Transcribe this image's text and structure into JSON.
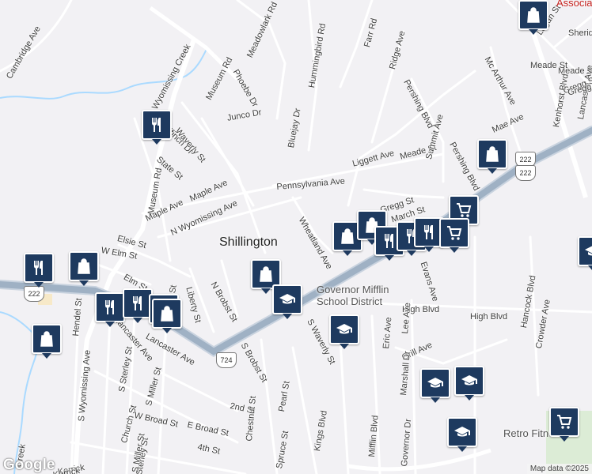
{
  "town": "Shillington",
  "labels": [
    "Cambridge Ave",
    "Meadowlark Rd",
    "Wyomissing Creek",
    "Museum Rd",
    "Phoebe Dr",
    "Hummingbird Rd",
    "Farr Rd",
    "Ridge Ave",
    "Logan St",
    "Meade St",
    "Kenhorst Blvd",
    "Lancaster Ave",
    "Mc Arthur Ave",
    "Pershing Blvd",
    "Gregg St",
    "Junco Dr",
    "Bluejay Dr",
    "Goldfinch Dr",
    "Waverly St",
    "State St",
    "Museum Rd",
    "Maple Ave",
    "Maple Ave",
    "N Wyomissing Ave",
    "Pennsylvania Ave",
    "Liggett Ave",
    "Meade St",
    "Summit Ave",
    "Pershing Blvd",
    "Gregg St",
    "March St",
    "Wheatland Ave",
    "Elsie St",
    "W Elm St",
    "N Brobst St",
    "Liberty St",
    "Hendel St",
    "S Wyomissing Ave",
    "S Sterley St",
    "Church St",
    "S Miller St",
    "Miller St",
    "Lancaster Ave",
    "S Brobst St",
    "S Waverly St",
    "High Blvd",
    "High Blvd",
    "Eric Ave",
    "Lee Ave",
    "Grill Ave",
    "Hancock Blvd",
    "Crowder Ave",
    "Marshall Dr",
    "Mifflin Blvd",
    "Governor Dr",
    "W Broad St",
    "E Broad St",
    "2nd St",
    "Chestnut St",
    "Pearl St",
    "Spruce St",
    "Kings Blvd",
    "4th St",
    "Kerrick",
    "Sterley St",
    "S Miller St",
    "Elm St",
    "Mae Ave",
    "Evans Ave",
    "Sheridan",
    "Meade St",
    "Gregg St",
    "Creek",
    "Lancaster Ave",
    "Kerrick"
  ],
  "poi_labels": {
    "school": "Governor Mifflin School District",
    "fitness": "Retro Fitness",
    "association": "Associa"
  },
  "shields": [
    "222",
    "222",
    "724",
    "222"
  ],
  "pins": [
    {
      "icon": "restaurant-icon"
    },
    {
      "icon": "shopping-bag-icon"
    },
    {
      "icon": "restaurant-icon"
    },
    {
      "icon": "shopping-bag-icon"
    },
    {
      "icon": "restaurant-icon"
    },
    {
      "icon": "restaurant-icon"
    },
    {
      "icon": "shopping-bag-icon"
    },
    {
      "icon": "shopping-bag-icon"
    },
    {
      "icon": "shopping-bag-icon"
    },
    {
      "icon": "school-icon"
    },
    {
      "icon": "shopping-bag-icon"
    },
    {
      "icon": "shopping-bag-icon"
    },
    {
      "icon": "restaurant-icon"
    },
    {
      "icon": "restaurant-icon"
    },
    {
      "icon": "restaurant-icon"
    },
    {
      "icon": "cart-icon"
    },
    {
      "icon": "cart-icon"
    },
    {
      "icon": "shopping-bag-icon"
    },
    {
      "icon": "shopping-bag-icon"
    },
    {
      "icon": "school-icon"
    },
    {
      "icon": "school-icon"
    },
    {
      "icon": "school-icon"
    },
    {
      "icon": "school-icon"
    },
    {
      "icon": "cart-icon"
    },
    {
      "icon": "school-icon"
    }
  ],
  "brand": "Google",
  "attribution": "Map data ©2025"
}
